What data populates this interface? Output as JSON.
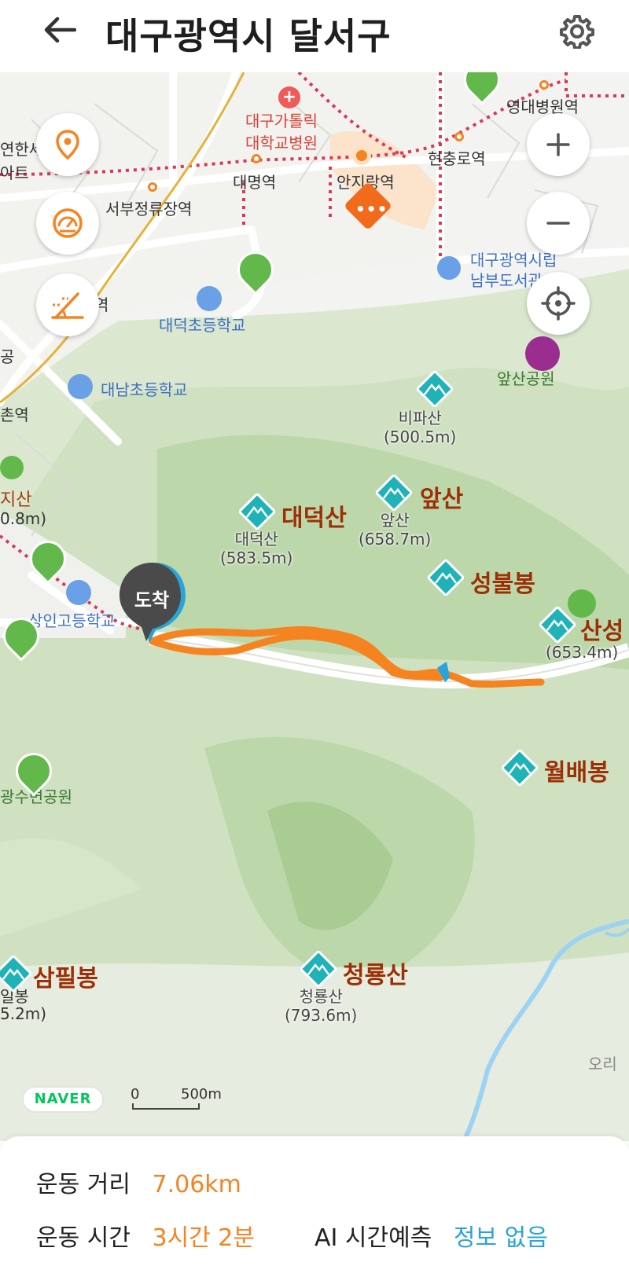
{
  "header": {
    "title": "대구광역시 달서구",
    "back_icon": "arrow-left-icon",
    "settings_icon": "gear-icon"
  },
  "map": {
    "places": {
      "catholic_hospital_1": "대구가톨릭",
      "catholic_hospital_2": "대학교병원",
      "yeongdae_station": "영대병원역",
      "hyeonchung_station": "현충로역",
      "daemyeong_station": "대명역",
      "anjirang_station": "안지랑역",
      "seobu_station": "서부정류장역",
      "library_1": "대구광역시립",
      "library_2": "남부도서관",
      "daedeok_school": "대덕초등학교",
      "daenam_school": "대남초등학교",
      "apsan_park": "앞산공원",
      "sangin_high": "상인고등학교",
      "gwangsu_park": "광수변공원",
      "left_cut_1": "연한세",
      "left_cut_2": "아트",
      "left_cut_3": "공",
      "left_cut_station": "촌역",
      "left_cut_mt_name": "지산",
      "left_cut_mt_height": "0.8m)",
      "left_cut_mt2_name": "일봉",
      "left_cut_mt2_height": "5.2m)",
      "right_cut": "오리",
      "cut_yeok": "역"
    },
    "peaks": {
      "bipasan": {
        "sub": "비파산",
        "height": "(500.5m)"
      },
      "apsan": {
        "name": "앞산",
        "sub": "앞산",
        "height": "(658.7m)"
      },
      "daedeoksan": {
        "name": "대덕산",
        "sub": "대덕산",
        "height": "(583.5m)"
      },
      "seongbulbong": {
        "name": "성불봉"
      },
      "sanseong": {
        "name": "산성",
        "height": "(653.4m)"
      },
      "wolbaebong": {
        "name": "월배봉"
      },
      "samphilbong": {
        "name": "삼필봉"
      },
      "cheongryongsan": {
        "name": "청룡산",
        "sub": "청룡산",
        "height": "(793.6m)"
      }
    },
    "arrive_marker": "도착",
    "naver_logo": "NAVER",
    "scale": {
      "zero": "0",
      "distance": "500m"
    },
    "buttons": {
      "location_icon": "location-pin-icon",
      "speed_icon": "speedometer-icon",
      "slope_icon": "slope-icon",
      "zoom_in_icon": "plus-icon",
      "zoom_out_icon": "minus-icon",
      "current_location_icon": "crosshair-icon"
    },
    "colors": {
      "route": "#f58320",
      "peak_label": "#9c2f05",
      "mountain_icon": "#1fb3b8"
    }
  },
  "stats": {
    "distance_label": "운동 거리",
    "distance_value": "7.06km",
    "time_label": "운동 시간",
    "time_value": "3시간 2분",
    "ai_label": "AI 시간예측",
    "ai_value": "정보 없음"
  }
}
